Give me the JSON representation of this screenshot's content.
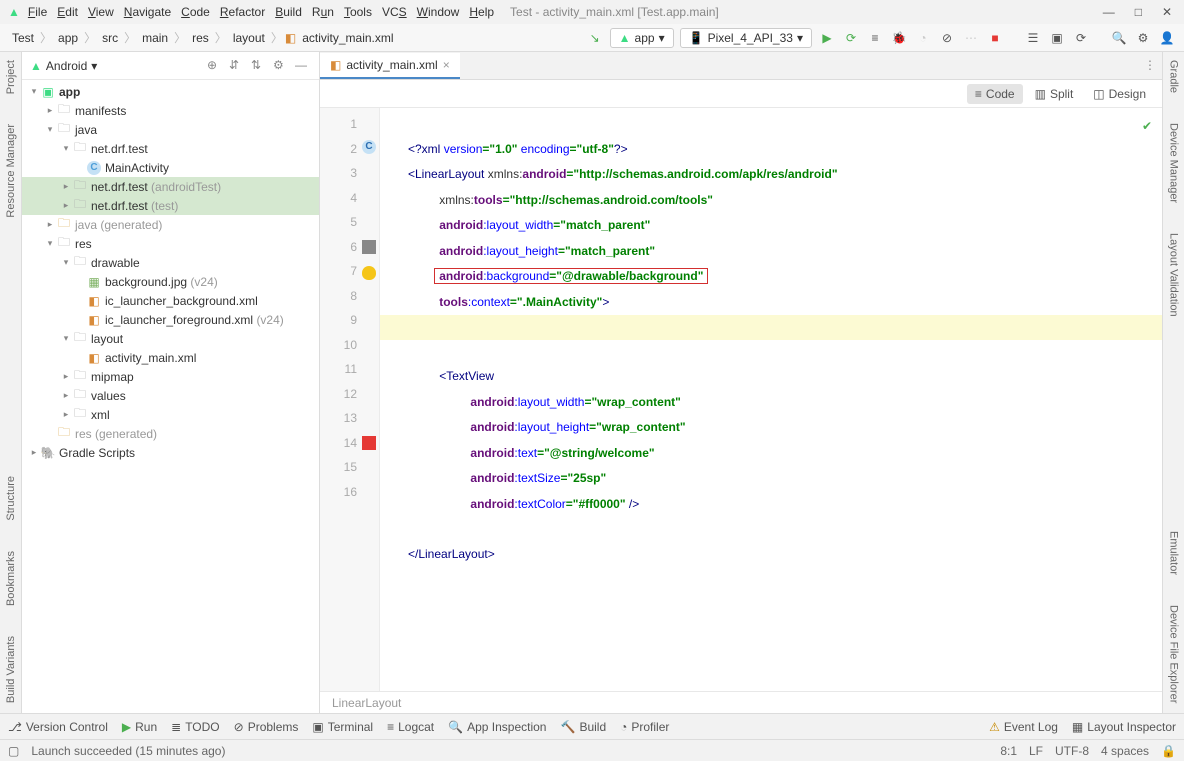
{
  "menu": [
    "File",
    "Edit",
    "View",
    "Navigate",
    "Code",
    "Refactor",
    "Build",
    "Run",
    "Tools",
    "VCS",
    "Window",
    "Help"
  ],
  "window_title": "Test - activity_main.xml [Test.app.main]",
  "breadcrumb": [
    "Test",
    "app",
    "src",
    "main",
    "res",
    "layout",
    "activity_main.xml"
  ],
  "run_config": "app",
  "device": "Pixel_4_API_33",
  "project_selector": "Android",
  "tree": {
    "app": "app",
    "manifests": "manifests",
    "java": "java",
    "pkg1": "net.drf.test",
    "main_activity": "MainActivity",
    "pkg2": "net.drf.test",
    "pkg2_suffix": "(androidTest)",
    "pkg3": "net.drf.test",
    "pkg3_suffix": "(test)",
    "java_gen": "java",
    "generated": "(generated)",
    "res": "res",
    "drawable": "drawable",
    "background_jpg": "background.jpg",
    "bg_suffix": "(v24)",
    "ic_bg": "ic_launcher_background.xml",
    "ic_fg": "ic_launcher_foreground.xml",
    "ic_fg_suffix": "(v24)",
    "layout": "layout",
    "activity_xml": "activity_main.xml",
    "mipmap": "mipmap",
    "values": "values",
    "xml": "xml",
    "res_gen": "res",
    "gradle": "Gradle Scripts"
  },
  "editor_tab": "activity_main.xml",
  "view_modes": {
    "code": "Code",
    "split": "Split",
    "design": "Design"
  },
  "code_lines": {
    "l1_a": "<?xml ",
    "l1_b": "version",
    "l1_c": "=\"1.0\" ",
    "l1_d": "encoding",
    "l1_e": "=\"utf-8\"",
    "l1_f": "?>",
    "l2_a": "<LinearLayout ",
    "l2_b": "xmlns:",
    "l2_c": "android",
    "l2_d": "=\"http://schemas.android.com/apk/res/android\"",
    "l3_a": "xmlns:",
    "l3_b": "tools",
    "l3_c": "=\"http://schemas.android.com/tools\"",
    "l4_a": "android",
    "l4_b": ":layout_width",
    "l4_c": "=\"match_parent\"",
    "l5_a": "android",
    "l5_b": ":layout_height",
    "l5_c": "=\"match_parent\"",
    "l6_a": "android",
    "l6_b": ":background",
    "l6_c": "=\"@drawable/background\"",
    "l7_a": "tools",
    "l7_b": ":context",
    "l7_c": "=\".MainActivity\"",
    "l7_d": ">",
    "l9_a": "<TextView",
    "l10_a": "android",
    "l10_b": ":layout_width",
    "l10_c": "=\"wrap_content\"",
    "l11_a": "android",
    "l11_b": ":layout_height",
    "l11_c": "=\"wrap_content\"",
    "l12_a": "android",
    "l12_b": ":text",
    "l12_c": "=\"@string/welcome\"",
    "l13_a": "android",
    "l13_b": ":textSize",
    "l13_c": "=\"25sp\"",
    "l14_a": "android",
    "l14_b": ":textColor",
    "l14_c": "=\"#ff0000\"",
    "l14_d": " />",
    "l16_a": "</LinearLayout>"
  },
  "editor_crumb": "LinearLayout",
  "left_tools": [
    "Project",
    "Resource Manager",
    "Structure",
    "Bookmarks",
    "Build Variants"
  ],
  "right_tools": [
    "Gradle",
    "Device Manager",
    "Layout Validation",
    "Emulator",
    "Device File Explorer"
  ],
  "bottom_tools": {
    "vc": "Version Control",
    "run": "Run",
    "todo": "TODO",
    "problems": "Problems",
    "terminal": "Terminal",
    "logcat": "Logcat",
    "appinsp": "App Inspection",
    "build": "Build",
    "profiler": "Profiler",
    "eventlog": "Event Log",
    "layinsp": "Layout Inspector"
  },
  "status": {
    "msg": "Launch succeeded (15 minutes ago)",
    "pos": "8:1",
    "sep": "LF",
    "enc": "UTF-8",
    "indent": "4 spaces"
  }
}
